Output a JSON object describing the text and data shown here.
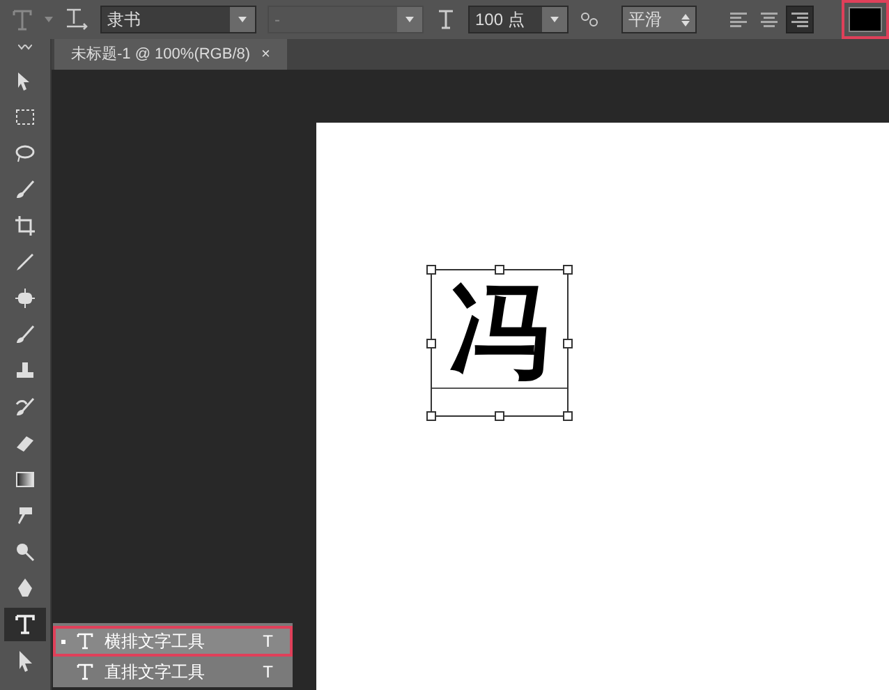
{
  "options_bar": {
    "font_family": "隶书",
    "font_style": "-",
    "font_size": "100 点",
    "antialias": "平滑",
    "align": [
      {
        "kind": "left",
        "selected": false
      },
      {
        "kind": "center",
        "selected": false
      },
      {
        "kind": "right",
        "selected": true
      }
    ],
    "color_highlighted": true
  },
  "document_tab": {
    "title": "未标题-1 @ 100%(RGB/8)",
    "close": "×"
  },
  "tools": [
    {
      "kind": "move",
      "selected": false
    },
    {
      "kind": "marquee",
      "selected": false
    },
    {
      "kind": "lasso",
      "selected": false
    },
    {
      "kind": "brush",
      "selected": false
    },
    {
      "kind": "crop",
      "selected": false
    },
    {
      "kind": "eyedropper",
      "selected": false
    },
    {
      "kind": "heal",
      "selected": false
    },
    {
      "kind": "brush",
      "selected": false
    },
    {
      "kind": "stamp",
      "selected": false
    },
    {
      "kind": "history",
      "selected": false
    },
    {
      "kind": "eraser",
      "selected": false
    },
    {
      "kind": "gradient",
      "selected": false
    },
    {
      "kind": "blur",
      "selected": false
    },
    {
      "kind": "dodge",
      "selected": false
    },
    {
      "kind": "pen",
      "selected": false
    },
    {
      "kind": "type",
      "selected": true
    },
    {
      "kind": "select",
      "selected": false
    }
  ],
  "canvas_text": "冯",
  "flyout_menu": [
    {
      "label": "横排文字工具",
      "shortcut": "T",
      "selected": true
    },
    {
      "label": "直排文字工具",
      "shortcut": "T",
      "selected": false
    }
  ]
}
